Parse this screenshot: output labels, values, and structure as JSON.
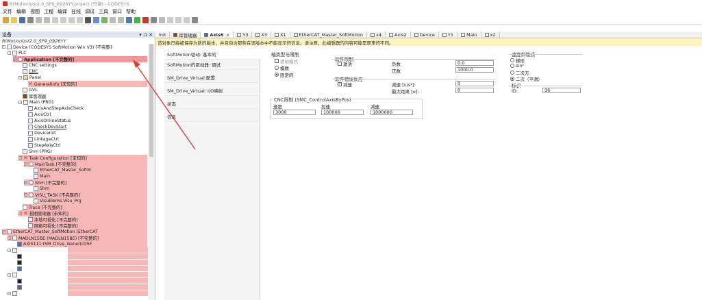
{
  "window": {
    "title": "RtMotionUsr2.0_SP9_0926YY.project (只读) - CODESYS"
  },
  "menu": [
    "文件",
    "编辑",
    "视图",
    "工程",
    "编译",
    "在线",
    "调试",
    "工具",
    "窗口",
    "帮助"
  ],
  "tree": {
    "header": "设备",
    "sub_title": "RtMotionUsr2.0_SP9_0926YY",
    "nodes": [
      "Device (CODESYS SoftMotion Win V3) [不完整]",
      "PLC",
      "Application [不完整的]",
      "CNC settings",
      "CNC",
      "Panel",
      "GeneralInfo [未知的]",
      "GVL",
      "库管理器",
      "Main (PRG)",
      "AxisAndStepAxisCheck",
      "AxisCtrl",
      "AxisOnlineStatus",
      "CheckDevStart",
      "DeviceInit",
      "LinkageCtrl",
      "StepAxisCtrl",
      "Shm (PRG)",
      "Task Configuration [未知的]",
      "MainTask [不完整的]",
      "EtherCAT_Master_SoftM",
      "Main",
      "Shm [不完整的]",
      "Shm",
      "VISU_TASK [不完整的]",
      "VisuElems.Visu_Prg",
      "Trace [不完整的]",
      "视图管理器 [未知的]",
      "本地可视化 [不完整的]",
      "网络可视化 [不完整的]",
      "EtherCAT_Master_SoftMotion (EtherCAT",
      "MADLN15BE (MADLN15BE) [不完整的]",
      "AXIS111 (SM_Drive_GenericDSF"
    ]
  },
  "tabs": [
    "Init",
    "库管理器",
    "Axis6",
    "Y3",
    "X3",
    "X1",
    "EtherCAT_Master_SoftMotion",
    "x4",
    "Axis2",
    "Device",
    "Y1",
    "Main",
    "x2"
  ],
  "warning": "该对象已经被保存为新的版本，并且包含那些在该版本中不能显示的信息。请注意，此编辑器的内容可能是原来的不同。",
  "nav": [
    "SoftMotion驱动: 基本的",
    "SoftMotion的驱动器: 调试",
    "SM_Drive_Virtual:配置",
    "SM_Drive_Virtual: I/O映射",
    "状态",
    "信息"
  ],
  "axis_type": {
    "title": "轴类型与限制",
    "opt_virtual": "虚轴模式",
    "opt_modulo": "模数",
    "opt_limited": "限定的"
  },
  "sw_limits": {
    "title": "软件限制",
    "activate": "激活",
    "neg_label": "负数",
    "neg_value": "0.0",
    "pos_label": "正数",
    "pos_value": "1000.0"
  },
  "sw_error": {
    "title": "软件错误反应",
    "decel_check": "减速",
    "decel_label": "减速 [u/s²]:",
    "decel_value": "0",
    "maxdist_label": "最大距离 [u]:",
    "maxdist_value": "0"
  },
  "cnc_limits": {
    "title": "CNC限制 (SMC_ControlAxisByPos)",
    "vel_label": "速度",
    "vel_value": "3000",
    "acc_label": "加速",
    "acc_value": "100000",
    "dec_label": "减速",
    "dec_value": "1000000"
  },
  "ramp": {
    "title": "速度斜坡式",
    "opts": [
      "梯形",
      "sin²",
      "二次方",
      "二次（平滑）"
    ]
  },
  "ident": {
    "title": "标识",
    "id_label": "ID:",
    "id_value": "36"
  }
}
